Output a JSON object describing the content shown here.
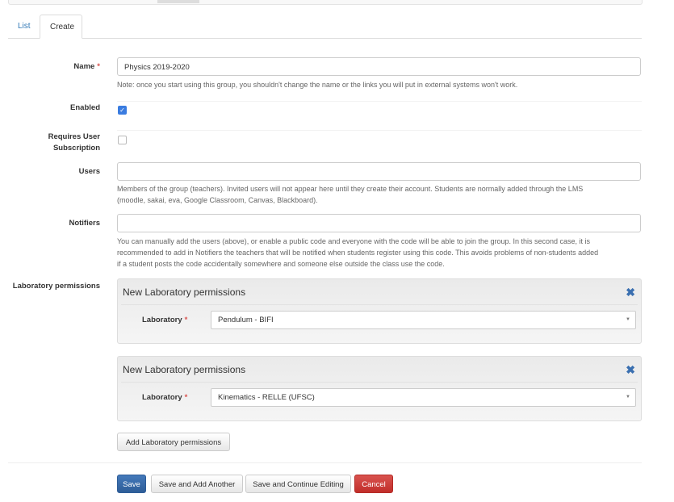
{
  "tabs": [
    {
      "label": "List"
    },
    {
      "label": "Create"
    }
  ],
  "form": {
    "name": {
      "label": "Name",
      "value": "Physics 2019-2020",
      "help": "Note: once you start using this group, you shouldn't change the name or the links you will put in external systems won't work."
    },
    "enabled": {
      "label": "Enabled",
      "checked": true
    },
    "requires_subscription": {
      "label_1": "Requires User",
      "label_2": "Subscription",
      "checked": false
    },
    "users": {
      "label": "Users",
      "value": "",
      "help_1": "Members of the group (teachers). Invited users will not appear here until they create their account. Students are normally added through the LMS",
      "help_2": "(moodle, sakai, eva, Google Classroom, Canvas, Blackboard)."
    },
    "notifiers": {
      "label": "Notifiers",
      "value": "",
      "help_1": "You can manually add the users (above), or enable a public code and everyone with the code will be able to join the group. In this second case, it is",
      "help_2": "recommended to add in Notifiers the teachers that will be notified when students register using this code. This avoids problems of non-students added",
      "help_3": "if a student posts the code accidentally somewhere and someone else outside the class use the code."
    },
    "lab_permissions": {
      "label": "Laboratory permissions",
      "panels": [
        {
          "title": "New Laboratory permissions",
          "field_label": "Laboratory",
          "value": "Pendulum - BIFI"
        },
        {
          "title": "New Laboratory permissions",
          "field_label": "Laboratory",
          "value": "Kinematics - RELLE (UFSC)"
        }
      ],
      "add_label": "Add Laboratory permissions"
    },
    "required_mark": "*"
  },
  "actions": {
    "save": "Save",
    "save_add": "Save and Add Another",
    "save_continue": "Save and Continue Editing",
    "cancel": "Cancel"
  },
  "colors": {
    "primary": "#3a6fb0",
    "danger": "#c9302c",
    "link": "#337ab7"
  }
}
